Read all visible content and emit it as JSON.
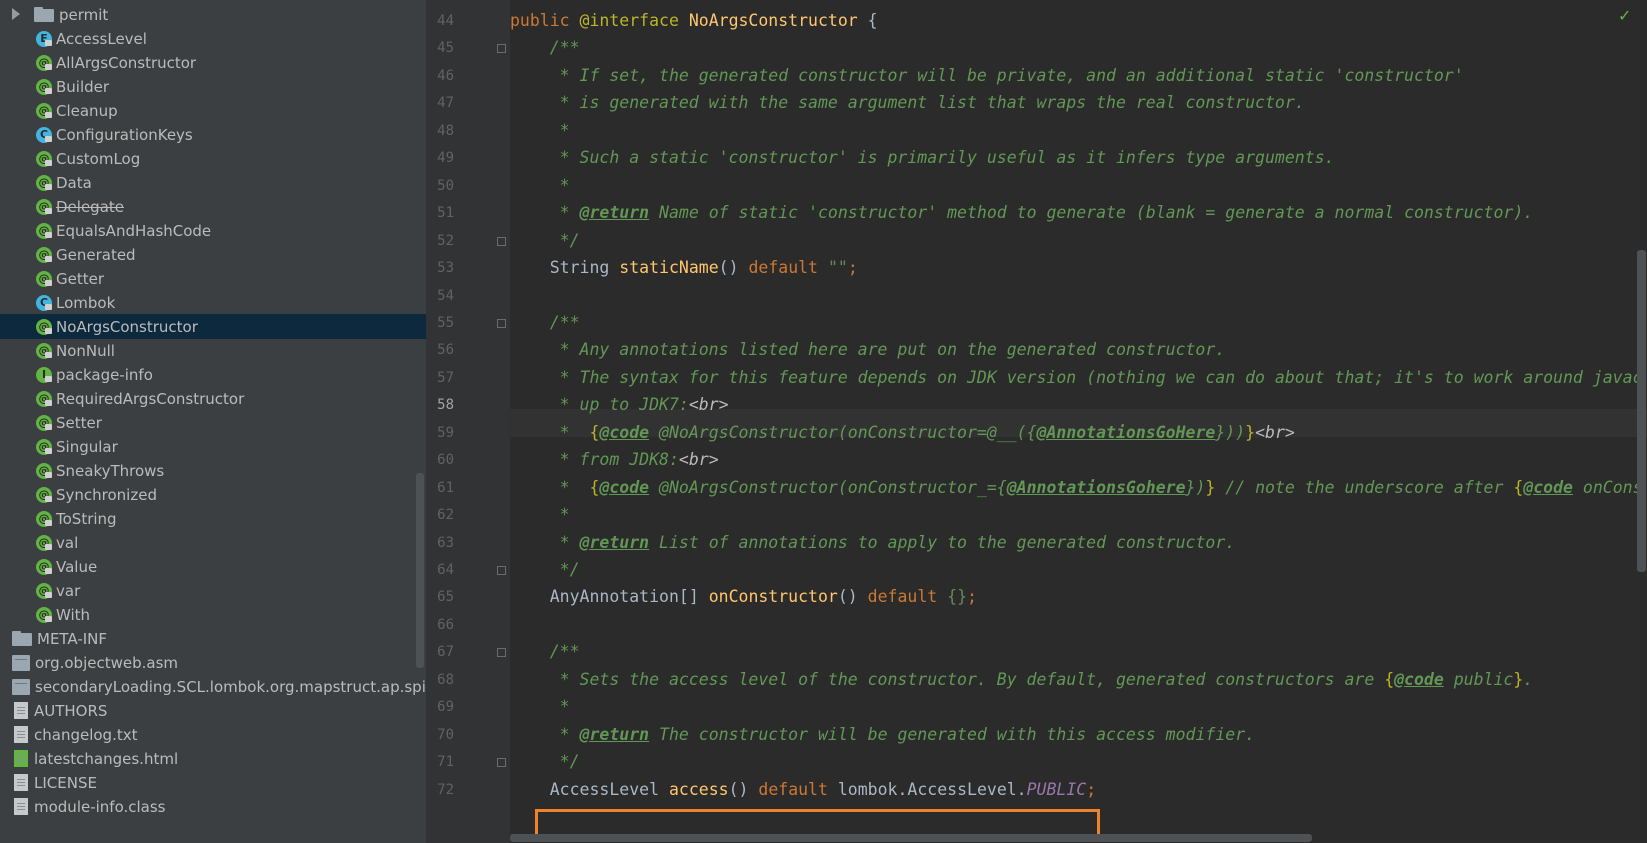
{
  "project_tree": {
    "items": [
      {
        "label": "permit",
        "icon": "folder-icon",
        "expand": "collapsed"
      },
      {
        "label": "AccessLevel",
        "icon": "enum-icon"
      },
      {
        "label": "AllArgsConstructor",
        "icon": "annotation-icon"
      },
      {
        "label": "Builder",
        "icon": "annotation-icon"
      },
      {
        "label": "Cleanup",
        "icon": "annotation-icon"
      },
      {
        "label": "ConfigurationKeys",
        "icon": "class-icon"
      },
      {
        "label": "CustomLog",
        "icon": "annotation-icon"
      },
      {
        "label": "Data",
        "icon": "annotation-icon"
      },
      {
        "label": "Delegate",
        "icon": "annotation-icon",
        "deprecated": true
      },
      {
        "label": "EqualsAndHashCode",
        "icon": "annotation-icon"
      },
      {
        "label": "Generated",
        "icon": "annotation-icon"
      },
      {
        "label": "Getter",
        "icon": "annotation-icon"
      },
      {
        "label": "Lombok",
        "icon": "class-icon"
      },
      {
        "label": "NoArgsConstructor",
        "icon": "annotation-icon",
        "selected": true
      },
      {
        "label": "NonNull",
        "icon": "annotation-icon"
      },
      {
        "label": "package-info",
        "icon": "interface-icon"
      },
      {
        "label": "RequiredArgsConstructor",
        "icon": "annotation-icon"
      },
      {
        "label": "Setter",
        "icon": "annotation-icon"
      },
      {
        "label": "Singular",
        "icon": "annotation-icon"
      },
      {
        "label": "SneakyThrows",
        "icon": "annotation-icon"
      },
      {
        "label": "Synchronized",
        "icon": "annotation-icon"
      },
      {
        "label": "ToString",
        "icon": "annotation-icon"
      },
      {
        "label": "val",
        "icon": "annotation-icon"
      },
      {
        "label": "Value",
        "icon": "annotation-icon"
      },
      {
        "label": "var",
        "icon": "annotation-icon"
      },
      {
        "label": "With",
        "icon": "annotation-icon"
      },
      {
        "label": "META-INF",
        "icon": "folder-icon"
      },
      {
        "label": "org.objectweb.asm",
        "icon": "package-icon"
      },
      {
        "label": "secondaryLoading.SCL.lombok.org.mapstruct.ap.spi",
        "icon": "package-icon"
      },
      {
        "label": "AUTHORS",
        "icon": "file-icon"
      },
      {
        "label": "changelog.txt",
        "icon": "text-file-icon"
      },
      {
        "label": "latestchanges.html",
        "icon": "html-file-icon"
      },
      {
        "label": "LICENSE",
        "icon": "file-icon"
      },
      {
        "label": "module-info.class",
        "icon": "class-file-icon"
      }
    ]
  },
  "editor": {
    "current_line": "58",
    "lines": [
      {
        "n": "44",
        "t": "public @interface NoArgsConstructor {"
      },
      {
        "n": "45",
        "t": "    /**"
      },
      {
        "n": "46",
        "t": "     * If set, the generated constructor will be private, and an additional static 'constructor'"
      },
      {
        "n": "47",
        "t": "     * is generated with the same argument list that wraps the real constructor."
      },
      {
        "n": "48",
        "t": "     *"
      },
      {
        "n": "49",
        "t": "     * Such a static 'constructor' is primarily useful as it infers type arguments."
      },
      {
        "n": "50",
        "t": "     *"
      },
      {
        "n": "51",
        "t": "     * @return Name of static 'constructor' method to generate (blank = generate a normal constructor)."
      },
      {
        "n": "52",
        "t": "     */"
      },
      {
        "n": "53",
        "t": "    String staticName() default \"\";"
      },
      {
        "n": "54",
        "t": ""
      },
      {
        "n": "55",
        "t": "    /**"
      },
      {
        "n": "56",
        "t": "     * Any annotations listed here are put on the generated constructor."
      },
      {
        "n": "57",
        "t": "     * The syntax for this feature depends on JDK version (nothing we can do about that; it's to work around javac"
      },
      {
        "n": "58",
        "t": "     * up to JDK7:<br>"
      },
      {
        "n": "59",
        "t": "     *  {@code @NoArgsConstructor(onConstructor=@__({@AnnotationsGoHere}))}<br>"
      },
      {
        "n": "60",
        "t": "     * from JDK8:<br>"
      },
      {
        "n": "61",
        "t": "     *  {@code @NoArgsConstructor(onConstructor_={@AnnotationsGohere})} // note the underscore after {@code onCons"
      },
      {
        "n": "62",
        "t": "     *"
      },
      {
        "n": "63",
        "t": "     * @return List of annotations to apply to the generated constructor."
      },
      {
        "n": "64",
        "t": "     */"
      },
      {
        "n": "65",
        "t": "    AnyAnnotation[] onConstructor() default {};"
      },
      {
        "n": "66",
        "t": ""
      },
      {
        "n": "67",
        "t": "    /**"
      },
      {
        "n": "68",
        "t": "     * Sets the access level of the constructor. By default, generated constructors are {@code public}."
      },
      {
        "n": "69",
        "t": "     *"
      },
      {
        "n": "70",
        "t": "     * @return The constructor will be generated with this access modifier."
      },
      {
        "n": "71",
        "t": "     */"
      },
      {
        "n": "72",
        "t": "    AccessLevel access() default lombok.AccessLevel.PUBLIC;"
      }
    ],
    "segments": {
      "l44": [
        "public ",
        "@interface ",
        "NoArgsConstructor",
        " {"
      ],
      "l51": [
        "@return",
        " Name of static 'constructor' method to generate (blank = generate a normal constructor)."
      ],
      "l53": [
        "String ",
        "staticName",
        "() ",
        "default ",
        "\"\"",
        ";"
      ],
      "l58": [
        "* up to JDK7:",
        "<br>"
      ],
      "l59": [
        "*  ",
        "{",
        "@code",
        " @NoArgsConstructor(onConstructor=@__({",
        "@AnnotationsGoHere",
        "}))",
        "}",
        "<br>"
      ],
      "l60": [
        "* from JDK8:",
        "<br>"
      ],
      "l61": [
        "*  ",
        "{",
        "@code",
        " @NoArgsConstructor(onConstructor_={",
        "@AnnotationsGohere",
        "})",
        "}",
        " // note the underscore after ",
        "{",
        "@code",
        " onCons"
      ],
      "l63": [
        "@return",
        " List of annotations to apply to the generated constructor."
      ],
      "l65": [
        "AnyAnnotation[] ",
        "onConstructor",
        "() ",
        "default ",
        "{}",
        ";"
      ],
      "l68": [
        "* Sets the access level of the constructor. By default, generated constructors are ",
        "{",
        "@code",
        " public",
        "}",
        "."
      ],
      "l70": [
        "@return",
        " The constructor will be generated with this access modifier."
      ],
      "l72": [
        "AccessLevel ",
        "access",
        "() ",
        "default ",
        "lombok.AccessLevel.",
        "PUBLIC",
        ";"
      ]
    }
  },
  "colors": {
    "sidebar_bg": "#3c3f41",
    "selection_bg": "#0d293e",
    "editor_bg": "#2b2b2b",
    "keyword": "#cc7832",
    "annotation": "#bbb529",
    "method": "#ffc66d",
    "doc_comment": "#629755",
    "constant": "#9876aa",
    "highlight_box": "#f0822d"
  }
}
